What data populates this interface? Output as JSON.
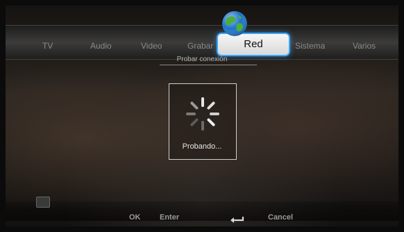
{
  "tabs": [
    {
      "label": "TV"
    },
    {
      "label": "Audio"
    },
    {
      "label": "Video"
    },
    {
      "label": "Grabar"
    },
    {
      "label": "Red",
      "active": true
    },
    {
      "label": "Sistema"
    },
    {
      "label": "Varios"
    }
  ],
  "section_title": "Probar conexión",
  "progress": {
    "label": "Probando..."
  },
  "footer": {
    "ok_key": "OK",
    "ok_action": "Enter",
    "back_action": "Cancel"
  },
  "icons": {
    "network": "globe-icon",
    "spinner": "loading-spinner-icon",
    "return": "return-arrow-icon"
  },
  "colors": {
    "accent": "#3aa7ff",
    "active_tab_bg": "#f0f0f0",
    "text_dim": "#8b8b8b"
  }
}
